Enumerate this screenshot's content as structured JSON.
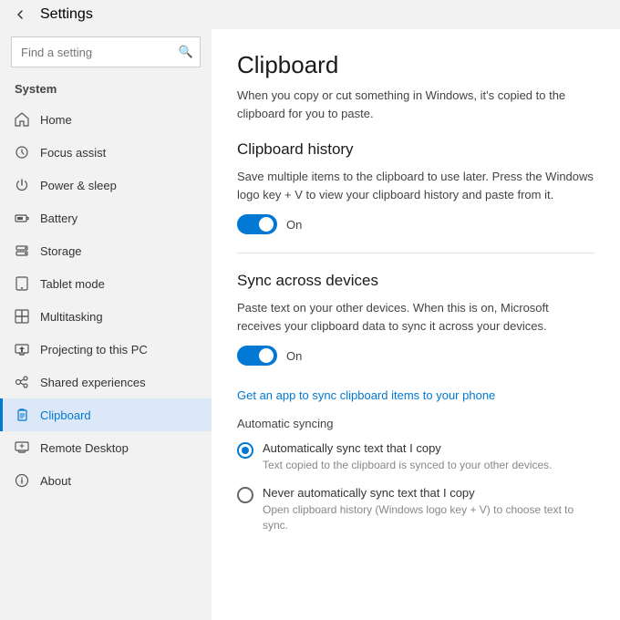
{
  "titleBar": {
    "title": "Settings",
    "backArrow": "←"
  },
  "sidebar": {
    "searchPlaceholder": "Find a setting",
    "searchIcon": "🔍",
    "sectionLabel": "System",
    "items": [
      {
        "id": "home",
        "label": "Home",
        "icon": "home"
      },
      {
        "id": "focus-assist",
        "label": "Focus assist",
        "icon": "focus"
      },
      {
        "id": "power-sleep",
        "label": "Power & sleep",
        "icon": "power"
      },
      {
        "id": "battery",
        "label": "Battery",
        "icon": "battery"
      },
      {
        "id": "storage",
        "label": "Storage",
        "icon": "storage"
      },
      {
        "id": "tablet-mode",
        "label": "Tablet mode",
        "icon": "tablet"
      },
      {
        "id": "multitasking",
        "label": "Multitasking",
        "icon": "multitask"
      },
      {
        "id": "projecting",
        "label": "Projecting to this PC",
        "icon": "project"
      },
      {
        "id": "shared-exp",
        "label": "Shared experiences",
        "icon": "shared"
      },
      {
        "id": "clipboard",
        "label": "Clipboard",
        "icon": "clipboard",
        "active": true
      },
      {
        "id": "remote-desktop",
        "label": "Remote Desktop",
        "icon": "remote"
      },
      {
        "id": "about",
        "label": "About",
        "icon": "about"
      }
    ]
  },
  "content": {
    "pageTitle": "Clipboard",
    "pageDescription": "When you copy or cut something in Windows, it's copied to the clipboard for you to paste.",
    "sections": [
      {
        "id": "clipboard-history",
        "title": "Clipboard history",
        "description": "Save multiple items to the clipboard to use later. Press the Windows logo key + V to view your clipboard history and paste from it.",
        "toggle": {
          "enabled": true,
          "label": "On"
        }
      },
      {
        "id": "sync-devices",
        "title": "Sync across devices",
        "description": "Paste text on your other devices. When this is on, Microsoft receives your clipboard data to sync it across your devices.",
        "toggle": {
          "enabled": true,
          "label": "On"
        },
        "link": "Get an app to sync clipboard items to your phone",
        "autoSyncLabel": "Automatic syncing",
        "radioOptions": [
          {
            "id": "auto-sync",
            "title": "Automatically sync text that I copy",
            "desc": "Text copied to the clipboard is synced to your other devices.",
            "selected": true
          },
          {
            "id": "never-sync",
            "title": "Never automatically sync text that I copy",
            "desc": "Open clipboard history (Windows logo key + V) to choose text to sync.",
            "selected": false
          }
        ]
      }
    ]
  },
  "colors": {
    "accent": "#0078d4",
    "activeBorder": "#0078d4",
    "activeBackground": "#dce8f8"
  }
}
